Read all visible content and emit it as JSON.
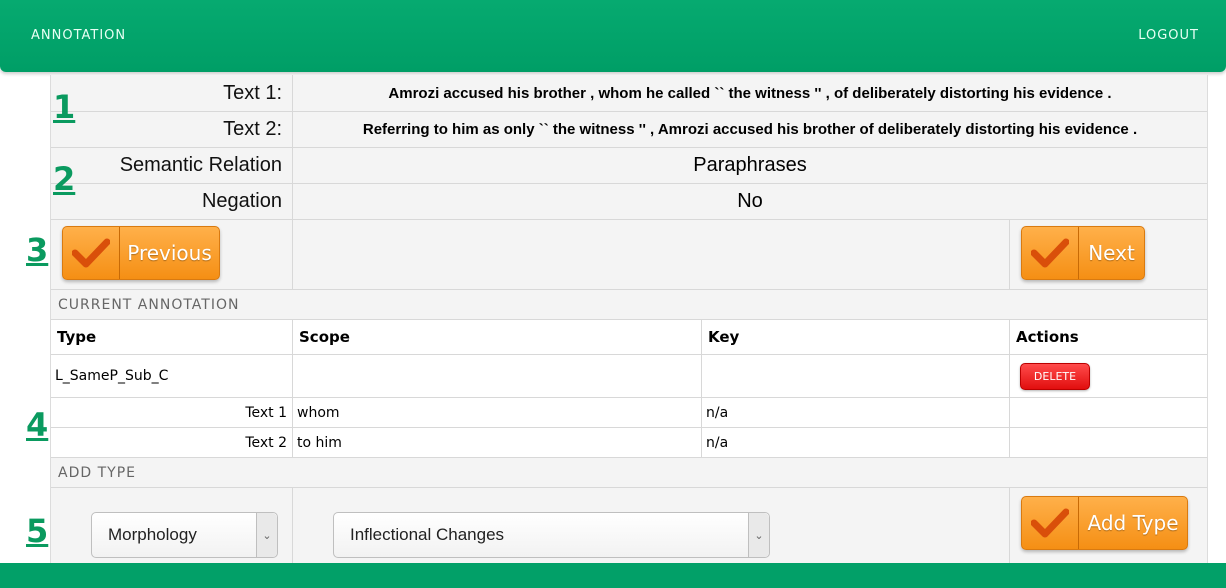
{
  "header": {
    "brand": "ANNOTATION",
    "logout": "LOGOUT"
  },
  "texts": {
    "text1_label": "Text 1:",
    "text1": "Amrozi accused his brother , whom he called `` the witness '' , of deliberately distorting his evidence .",
    "text2_label": "Text 2:",
    "text2": "Referring to him as only `` the witness '' , Amrozi accused his brother of deliberately distorting his evidence ."
  },
  "relation": {
    "semantic_label": "Semantic Relation",
    "semantic_value": "Paraphrases",
    "negation_label": "Negation",
    "negation_value": "No"
  },
  "nav": {
    "previous": "Previous",
    "next": "Next"
  },
  "current": {
    "title": "CURRENT ANNOTATION",
    "headers": [
      "Type",
      "Scope",
      "Key",
      "Actions"
    ],
    "type_value": "L_SameP_Sub_C",
    "delete_label": "DELETE",
    "rows": [
      {
        "label": "Text 1",
        "scope": "whom",
        "key": "n/a"
      },
      {
        "label": "Text 2",
        "scope": "to him",
        "key": "n/a"
      }
    ]
  },
  "add": {
    "title": "ADD TYPE",
    "category": "Morphology",
    "subtype": "Inflectional Changes",
    "button": "Add Type"
  },
  "markers": [
    "1",
    "2",
    "3",
    "4",
    "5"
  ],
  "colors": {
    "green": "#009e66",
    "orange": "#f5961e",
    "red": "#e81a1a"
  }
}
